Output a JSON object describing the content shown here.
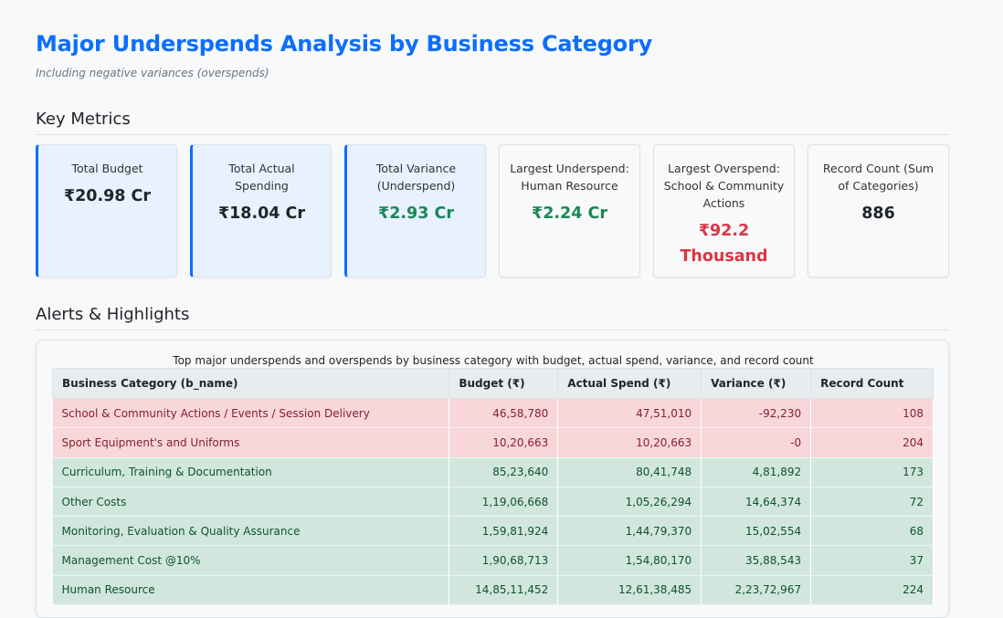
{
  "header": {
    "title": "Major Underspends Analysis by Business Category",
    "subtitle": "Including negative variances (overspends)"
  },
  "sections": {
    "metrics_title": "Key Metrics",
    "alerts_title": "Alerts & Highlights"
  },
  "metrics": [
    {
      "label": "Total Budget",
      "value": "₹20.98 Cr",
      "highlight": true,
      "tone": "default"
    },
    {
      "label": "Total Actual Spending",
      "value": "₹18.04 Cr",
      "highlight": true,
      "tone": "default"
    },
    {
      "label": "Total Variance (Underspend)",
      "value": "₹2.93 Cr",
      "highlight": true,
      "tone": "green"
    },
    {
      "label": "Largest Underspend: Human Resource",
      "value": "₹2.24 Cr",
      "highlight": false,
      "tone": "green"
    },
    {
      "label": "Largest Overspend: School & Community Actions",
      "value": "₹92.2 Thousand",
      "highlight": false,
      "tone": "red"
    },
    {
      "label": "Record Count (Sum of Categories)",
      "value": "886",
      "highlight": false,
      "tone": "default"
    }
  ],
  "table": {
    "caption": "Top major underspends and overspends by business category with budget, actual spend, variance, and record count",
    "headers": [
      "Business Category (b_name)",
      "Budget (₹)",
      "Actual Spend (₹)",
      "Variance (₹)",
      "Record Count"
    ],
    "rows": [
      {
        "status": "over",
        "cells": [
          "School & Community Actions / Events / Session Delivery",
          "46,58,780",
          "47,51,010",
          "-92,230",
          "108"
        ]
      },
      {
        "status": "over",
        "cells": [
          "Sport Equipment's and Uniforms",
          "10,20,663",
          "10,20,663",
          "-0",
          "204"
        ]
      },
      {
        "status": "under",
        "cells": [
          "Curriculum, Training & Documentation",
          "85,23,640",
          "80,41,748",
          "4,81,892",
          "173"
        ]
      },
      {
        "status": "under",
        "cells": [
          "Other Costs",
          "1,19,06,668",
          "1,05,26,294",
          "14,64,374",
          "72"
        ]
      },
      {
        "status": "under",
        "cells": [
          "Monitoring, Evaluation & Quality Assurance",
          "1,59,81,924",
          "1,44,79,370",
          "15,02,554",
          "68"
        ]
      },
      {
        "status": "under",
        "cells": [
          "Management Cost @10%",
          "1,90,68,713",
          "1,54,80,170",
          "35,88,543",
          "37"
        ]
      },
      {
        "status": "under",
        "cells": [
          "Human Resource",
          "14,85,11,452",
          "12,61,38,485",
          "2,23,72,967",
          "224"
        ]
      }
    ]
  },
  "colors": {
    "title": "#0d6efd",
    "green": "#198754",
    "red": "#dc3545",
    "overspend_row": "#f8d7da",
    "underspend_row": "#d1e7dd"
  }
}
